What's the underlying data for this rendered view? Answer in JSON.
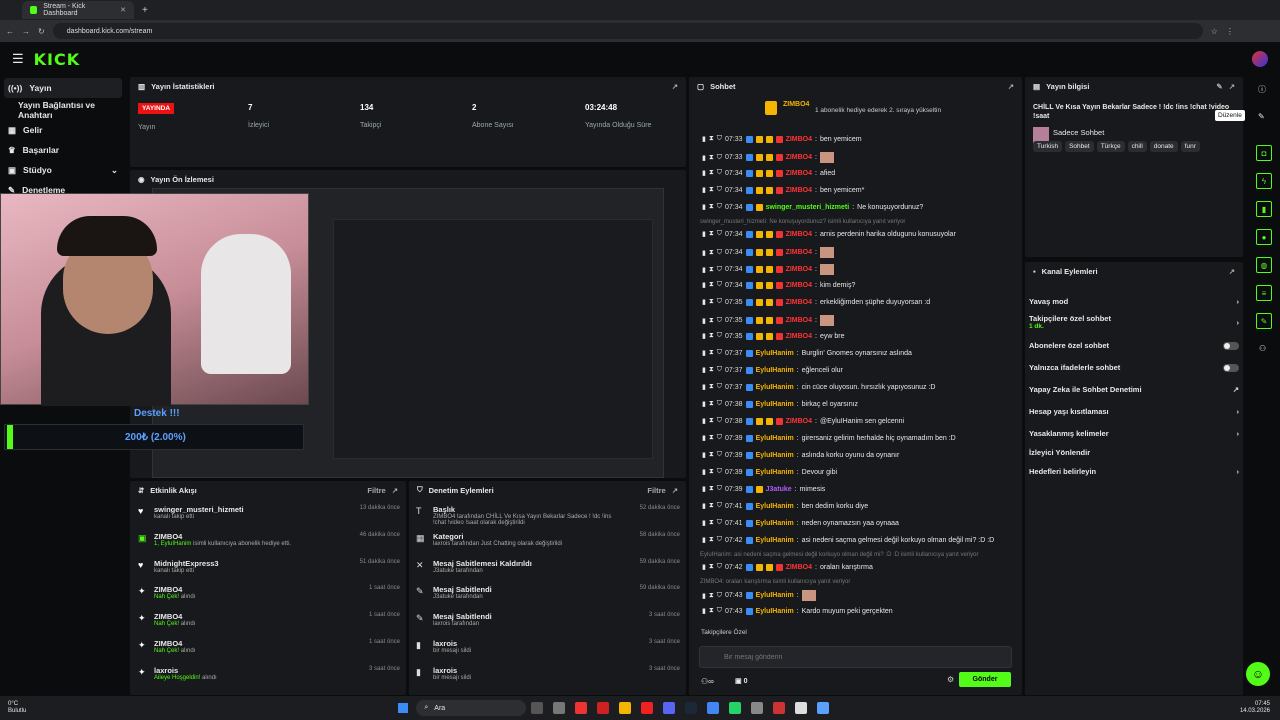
{
  "browser": {
    "tab_title": "Stream - Kick Dashboard",
    "url": "dashboard.kick.com/stream"
  },
  "brand": {
    "logo": "KICK",
    "accent": "#53fc18"
  },
  "sidebar": {
    "items": [
      {
        "label": "Yayın",
        "icon": "broadcast-icon"
      },
      {
        "label": "Yayın Bağlantısı ve Anahtarı",
        "icon": "key-icon"
      },
      {
        "label": "Gelir",
        "icon": "money-icon"
      },
      {
        "label": "Başarılar",
        "icon": "trophy-icon"
      },
      {
        "label": "Stüdyo",
        "icon": "studio-icon"
      },
      {
        "label": "Denetleme",
        "icon": "wrench-icon"
      }
    ]
  },
  "stats": {
    "title": "Yayın İstatistikleri",
    "live": "YAYINDA",
    "live_label": "Yayın",
    "viewers": "7",
    "viewers_label": "İzleyici",
    "followers": "134",
    "followers_label": "Takipçi",
    "subs": "2",
    "subs_label": "Abone Sayısı",
    "duration": "03:24:48",
    "duration_label": "Yayında Olduğu Süre"
  },
  "preview": {
    "title": "Yayın Ön İzlemesi",
    "destek": "Destek !!!",
    "goal": "200₺ (2.00%)"
  },
  "events": {
    "title": "Etkinlik Akışı",
    "filter": "Filtre",
    "items": [
      {
        "name": "swinger_musteri_hizmeti",
        "desc": "kanalı takip etti",
        "time": "13 dakika önce",
        "icon": "heart-icon"
      },
      {
        "name": "ZIMBO4",
        "desc": "isimli kullanıcıya abonelik hediye etti.",
        "hl": "1, EyluIHanim",
        "time": "46 dakika önce",
        "icon": "gift-icon"
      },
      {
        "name": "MidnightExpress3",
        "desc": "kanalı takip etti",
        "time": "51 dakika önce",
        "icon": "heart-icon"
      },
      {
        "name": "ZIMBO4",
        "hl": "Nah Çek!",
        "desc": "alındı",
        "time": "1 saat önce",
        "icon": "reward-icon"
      },
      {
        "name": "ZIMBO4",
        "hl": "Nah Çek!",
        "desc": "alındı",
        "time": "1 saat önce",
        "icon": "reward-icon"
      },
      {
        "name": "ZIMBO4",
        "hl": "Nah Çek!",
        "desc": "alındı",
        "time": "1 saat önce",
        "icon": "reward-icon"
      },
      {
        "name": "laxrois",
        "hl": "Aileye Hoşgeldin!",
        "desc": "alındı",
        "time": "3 saat önce",
        "icon": "reward-icon"
      }
    ]
  },
  "moderation": {
    "title": "Denetim Eylemleri",
    "filter": "Filtre",
    "items": [
      {
        "t": "Başlık",
        "s": "ZIMBO4 tarafından CHİLL Ve Kısa Yayın Bekarlar Sadece ! !dc !ins !chat !video !saat olarak değiştirildi",
        "time": "52 dakika önce",
        "icon": "text-icon"
      },
      {
        "t": "Kategori",
        "s": "laxrois tarafından Just Chatting olarak değiştirildi",
        "time": "58 dakika önce",
        "icon": "category-icon"
      },
      {
        "t": "Mesaj Sabitlemesi Kaldırıldı",
        "s": "J3atuke tarafından",
        "time": "59 dakika önce",
        "icon": "unpin-icon"
      },
      {
        "t": "Mesaj Sabitlendi",
        "s": "J3atuke tarafından",
        "time": "59 dakika önce",
        "icon": "pin-icon"
      },
      {
        "t": "Mesaj Sabitlendi",
        "s": "laxrois tarafından",
        "time": "3 saat önce",
        "icon": "pin-icon"
      },
      {
        "t": "laxrois",
        "s": "bir mesajı sildi",
        "time": "3 saat önce",
        "icon": "trash-icon"
      },
      {
        "t": "laxrois",
        "s": "bir mesajı sildi",
        "time": "3 saat önce",
        "icon": "trash-icon"
      }
    ]
  },
  "chat": {
    "title": "Sohbet",
    "pinned_user": "ZIMBO4",
    "pinned_text": "1 abonelik hediye ederek 2. sıraya yükseltin",
    "placeholder": "Bir mesaj gönderin",
    "send": "Gönder",
    "followers_only": "Takipçilere Özel",
    "count": "0",
    "messages": [
      {
        "t": "07:33",
        "u": "ZIMBO4",
        "c": "#f33",
        "m": "ben yemicem"
      },
      {
        "t": "07:33",
        "u": "ZIMBO4",
        "c": "#f33",
        "m": ""
      },
      {
        "t": "07:34",
        "u": "ZIMBO4",
        "c": "#f33",
        "m": "afied"
      },
      {
        "t": "07:34",
        "u": "ZIMBO4",
        "c": "#f33",
        "m": "ben yemicem*"
      },
      {
        "t": "07:34",
        "u": "swinger_musteri_hizmeti",
        "c": "#53fc18",
        "m": "Ne konuşuyordunuz?"
      },
      {
        "note": "swinger_musteri_hizmeti: Ne konuşuyordunuz? isimli kullanıcıya yanıt veriyor"
      },
      {
        "t": "07:34",
        "u": "ZIMBO4",
        "c": "#f33",
        "m": "arnis perdenin harika oldugunu konusuyolar"
      },
      {
        "t": "07:34",
        "u": "ZIMBO4",
        "c": "#f33",
        "m": ""
      },
      {
        "t": "07:34",
        "u": "ZIMBO4",
        "c": "#f33",
        "m": ""
      },
      {
        "t": "07:34",
        "u": "ZIMBO4",
        "c": "#f33",
        "m": "kim demiş?"
      },
      {
        "t": "07:35",
        "u": "ZIMBO4",
        "c": "#f33",
        "m": "erkekliğimden şüphe duyuyorsan :d"
      },
      {
        "t": "07:35",
        "u": "ZIMBO4",
        "c": "#f33",
        "m": ""
      },
      {
        "t": "07:35",
        "u": "ZIMBO4",
        "c": "#f33",
        "m": "eyw bre"
      },
      {
        "t": "07:37",
        "u": "EyluIHanim",
        "c": "#f5b400",
        "m": "Burglin' Gnomes oynarsınız aslında"
      },
      {
        "t": "07:37",
        "u": "EyluIHanim",
        "c": "#f5b400",
        "m": "eğlenceli olur"
      },
      {
        "t": "07:37",
        "u": "EyluIHanim",
        "c": "#f5b400",
        "m": "cin cüce oluyosun. hırsızlık yapıyosunuz :D"
      },
      {
        "t": "07:38",
        "u": "EyluIHanim",
        "c": "#f5b400",
        "m": "birkaç el oyarsınız"
      },
      {
        "t": "07:38",
        "u": "ZIMBO4",
        "c": "#f33",
        "m": "@EyluIHanim sen gelcenni"
      },
      {
        "t": "07:39",
        "u": "EyluIHanim",
        "c": "#f5b400",
        "m": "girersaniz gelirim herhalde hiç oynamadım ben :D"
      },
      {
        "t": "07:39",
        "u": "EyluIHanim",
        "c": "#f5b400",
        "m": "aslında korku oyunu da oynanır"
      },
      {
        "t": "07:39",
        "u": "EyluIHanim",
        "c": "#f5b400",
        "m": "Devour gibi"
      },
      {
        "t": "07:39",
        "u": "J3atuke",
        "c": "#b05cff",
        "m": "mimesis"
      },
      {
        "t": "07:41",
        "u": "EyluIHanim",
        "c": "#f5b400",
        "m": "ben dedim korku diye"
      },
      {
        "t": "07:41",
        "u": "EyluIHanim",
        "c": "#f5b400",
        "m": "neden oynamazsın yaa oynaaa"
      },
      {
        "t": "07:42",
        "u": "EyluIHanim",
        "c": "#f5b400",
        "m": "asi nedeni saçma gelmesi değil korkuyo olman değil mi? :D :D"
      },
      {
        "note": "EyluIHanim: asi nedeni saçma gelmesi değil korkuyo olman değil mi? :D :D isimli kullanıcıya yanıt veriyor"
      },
      {
        "t": "07:42",
        "u": "ZIMBO4",
        "c": "#f33",
        "m": "oraları karıştırma"
      },
      {
        "note": "ZIMBO4: oraları karıştırma isimli kullanıcıya yanıt veriyor"
      },
      {
        "t": "07:43",
        "u": "EyluIHanim",
        "c": "#f5b400",
        "m": ""
      },
      {
        "t": "07:43",
        "u": "EyluIHanim",
        "c": "#f5b400",
        "m": "Kardo muyum peki gerçekten"
      }
    ]
  },
  "info": {
    "title": "Yayın bilgisi",
    "edit_tip": "Düzenle",
    "stream_title": "CHİLL Ve Kısa Yayın Bekarlar Sadece ! !dc !ins !chat !video !saat",
    "category": "Sadece Sohbet",
    "tags": [
      "Turkish",
      "Sohbet",
      "Türkçe",
      "chill",
      "donate",
      "funr"
    ]
  },
  "channel_actions": {
    "title": "Kanal Eylemleri",
    "items": [
      {
        "label": "Yavaş mod",
        "kind": "chev"
      },
      {
        "label": "Takipçilere özel sohbet",
        "sub": "1 dk.",
        "kind": "chev"
      },
      {
        "label": "Abonelere özel sohbet",
        "kind": "toggle"
      },
      {
        "label": "Yalnızca ifadelerle sohbet",
        "kind": "toggle"
      },
      {
        "label": "Yapay Zeka ile Sohbet Denetimi",
        "kind": "ext"
      },
      {
        "label": "Hesap yaşı kısıtlaması",
        "kind": "chev"
      },
      {
        "label": "Yasaklanmış kelimeler",
        "kind": "chev"
      },
      {
        "label": "İzleyici Yönlendir",
        "kind": "none"
      },
      {
        "label": "Hedefleri belirleyin",
        "kind": "chev"
      }
    ]
  },
  "taskbar": {
    "weather_temp": "0°C",
    "weather_desc": "Bulutlu",
    "search": "Ara",
    "time": "07:45",
    "date": "14.03.2026"
  }
}
